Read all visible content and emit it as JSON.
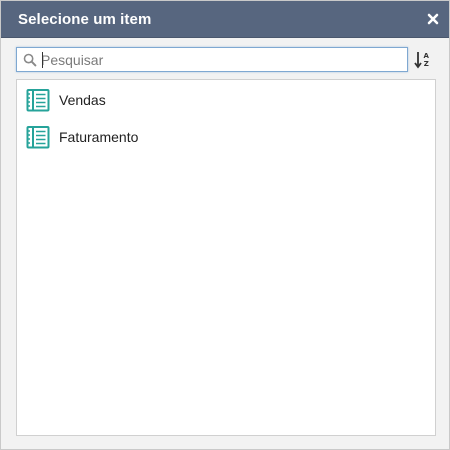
{
  "dialog": {
    "title": "Selecione um item",
    "close_icon": "close-icon"
  },
  "search": {
    "placeholder": "Pesquisar",
    "value": "",
    "icon": "search-icon"
  },
  "sort": {
    "icon": "sort-alpha-asc-icon"
  },
  "list": {
    "items": [
      {
        "label": "Vendas",
        "icon": "ledger-book-icon"
      },
      {
        "label": "Faturamento",
        "icon": "ledger-book-icon"
      }
    ]
  },
  "colors": {
    "titlebar": "#57667f",
    "accent_icon": "#26a39a",
    "search_border": "#7fa8d1"
  }
}
